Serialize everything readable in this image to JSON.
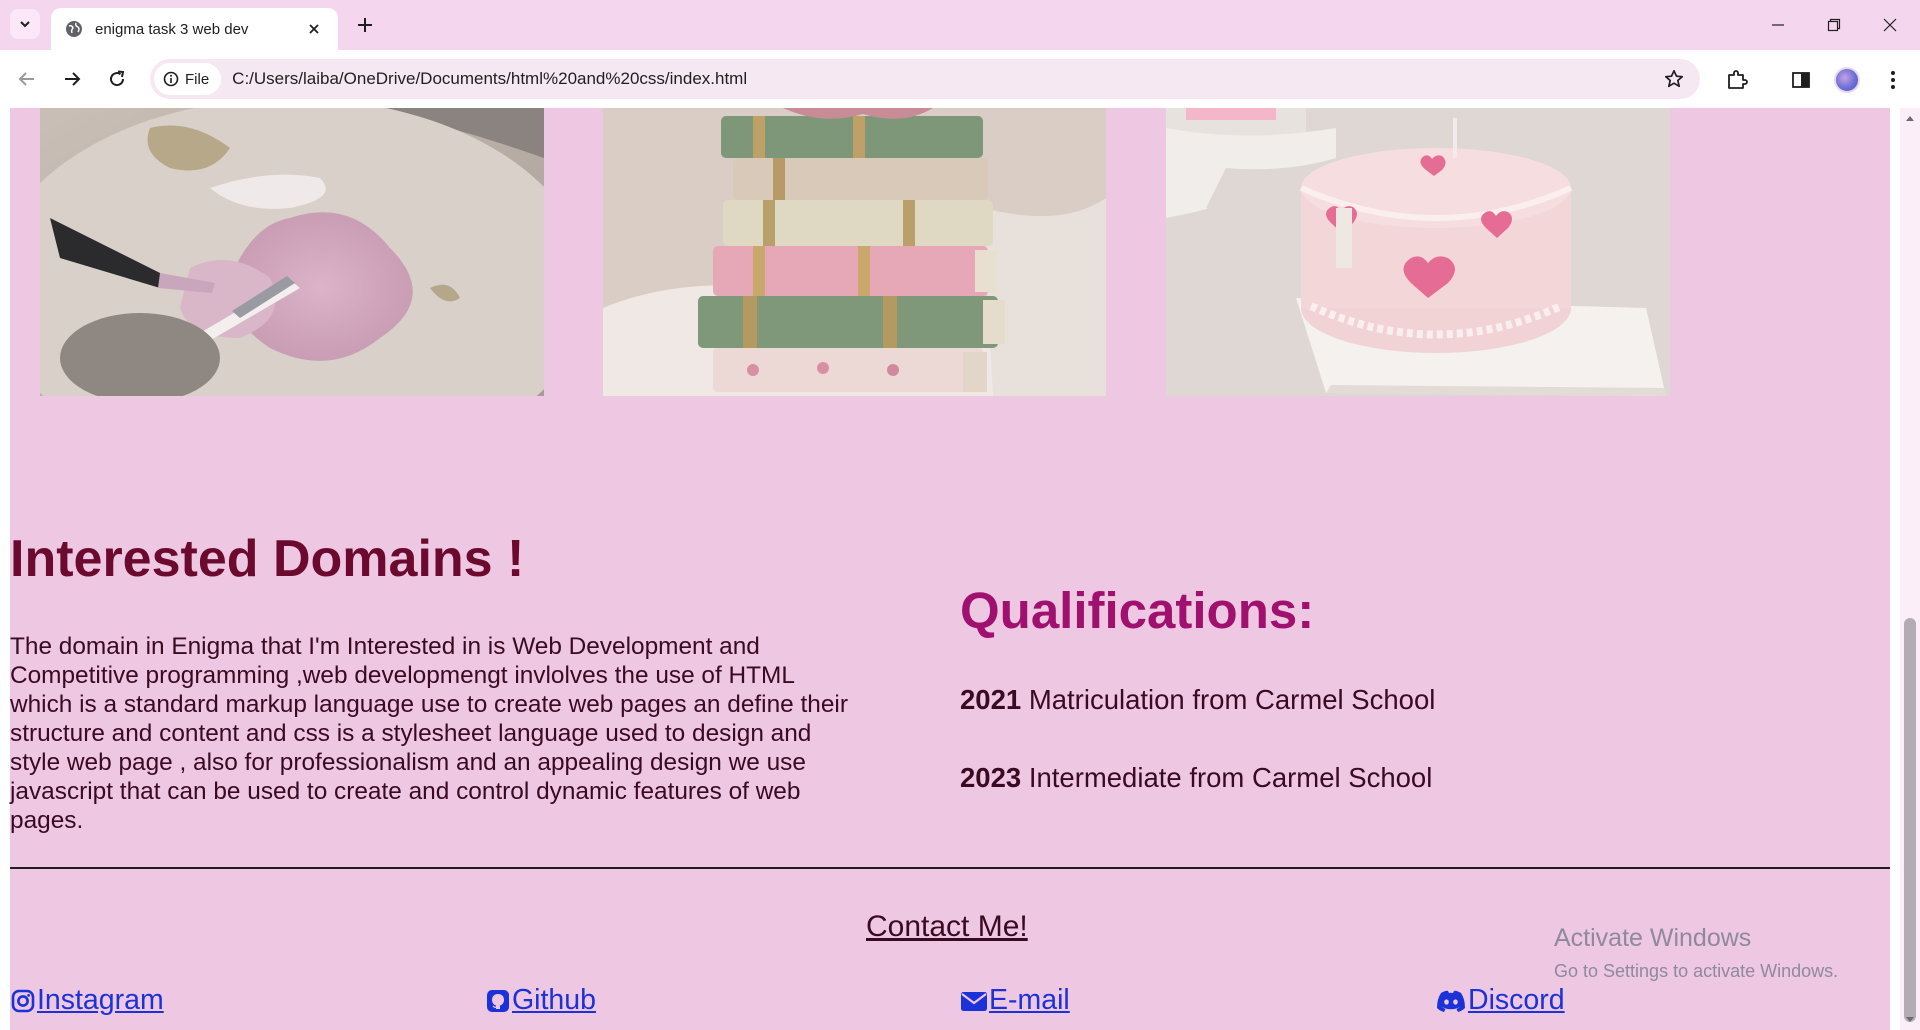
{
  "browser": {
    "tab_title": "enigma task 3 web dev",
    "chip_label": "File",
    "url": "C:/Users/laiba/OneDrive/Documents/html%20and%20css/index.html"
  },
  "gallery": [
    {
      "alt": "pink paint palette with brush"
    },
    {
      "alt": "stack of vintage books"
    },
    {
      "alt": "pink heart cake"
    }
  ],
  "domains": {
    "heading": "Interested Domains !",
    "text": "The domain in Enigma that I'm Interested in is Web Development and Competitive programming ,web developmengt invlolves the use of HTML which is a standard markup language use to create web pages an define their structure and content and css is a stylesheet language used to design and style web page , also for professionalism and an appealing design we use javascript that can be used to create and control dynamic features of web pages."
  },
  "qualifications": {
    "heading": "Qualifications:",
    "items": [
      {
        "year": "2021",
        "text": " Matriculation from Carmel School"
      },
      {
        "year": "2023",
        "text": " Intermediate from Carmel School"
      }
    ]
  },
  "contact": {
    "heading": "Contact Me!",
    "links": [
      {
        "label": "Instagram",
        "icon": "instagram-icon"
      },
      {
        "label": "Github",
        "icon": "github-icon"
      },
      {
        "label": "E-mail",
        "icon": "envelope-icon"
      },
      {
        "label": "Discord",
        "icon": "discord-icon"
      }
    ]
  },
  "watermark": {
    "title": "Activate Windows",
    "subtitle": "Go to Settings to activate Windows."
  },
  "colors": {
    "page_bg": "#eec7e3",
    "heading_dark": "#6b0a2e",
    "heading_accent": "#a0106e",
    "link": "#1a32d8"
  }
}
